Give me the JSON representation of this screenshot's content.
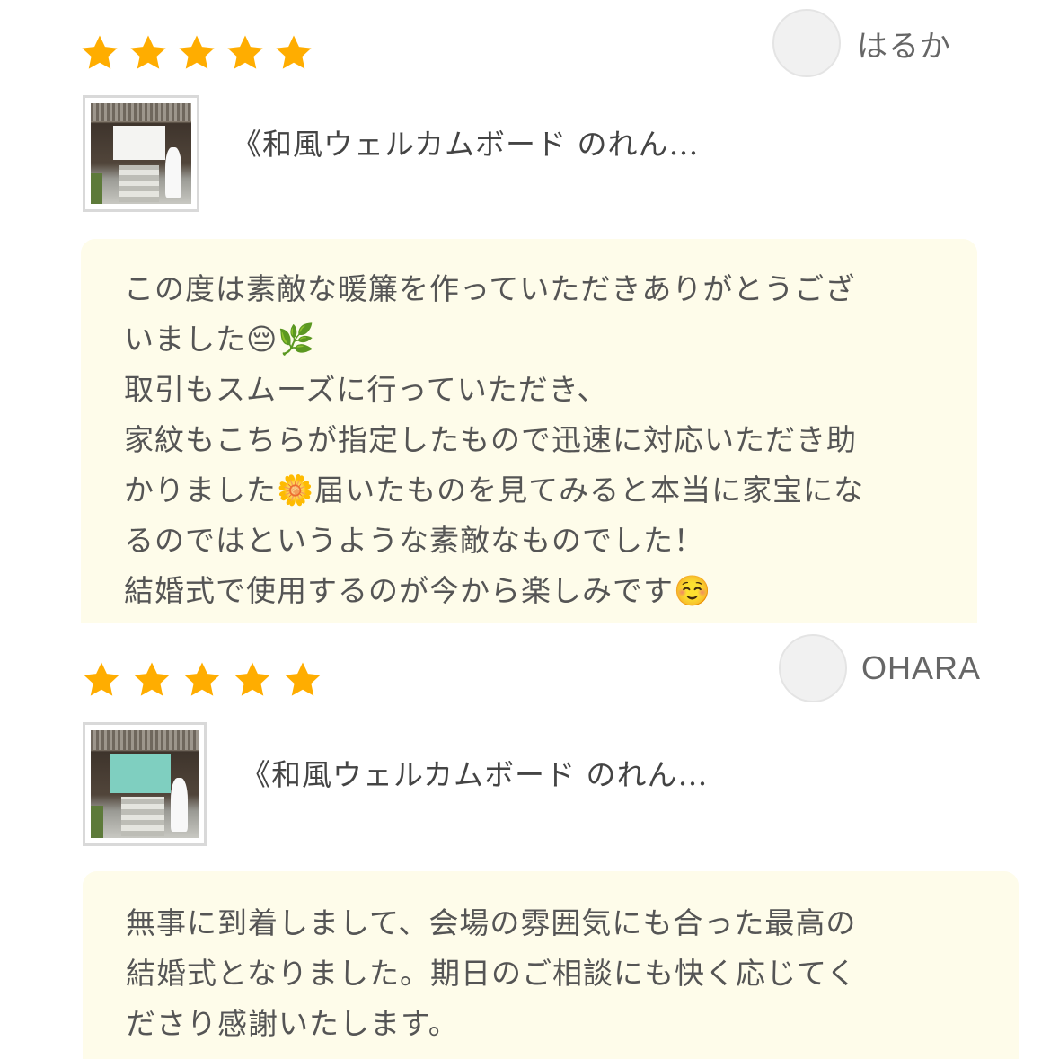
{
  "reviews": [
    {
      "rating": 5,
      "rating_max": 5,
      "username": "はるか",
      "product_title": "《和風ウェルカムボード のれん…",
      "comment_lines": [
        "この度は素敵な暖簾を作っていただきありがとうござ",
        "いました😔🌿",
        "取引もスムーズに行っていただき、",
        "家紋もこちらが指定したもので迅速に対応いただき助",
        "かりました🌼届いたものを見てみると本当に家宝にな",
        "るのではというような素敵なものでした！",
        "結婚式で使用するのが今から楽しみです☺️"
      ]
    },
    {
      "rating": 5,
      "rating_max": 5,
      "username": "OHARA",
      "product_title": "《和風ウェルカムボード のれん…",
      "comment_lines": [
        "無事に到着しまして、会場の雰囲気にも合った最高の",
        "結婚式となりました。期日のご相談にも快く応じてく",
        "ださり感謝いたします。"
      ]
    }
  ],
  "colors": {
    "star": "#ffad00",
    "comment_bg": "#fefcea",
    "avatar_bg": "#f1f1f1"
  },
  "icons": {
    "star": "star-icon",
    "avatar": "avatar-placeholder"
  }
}
